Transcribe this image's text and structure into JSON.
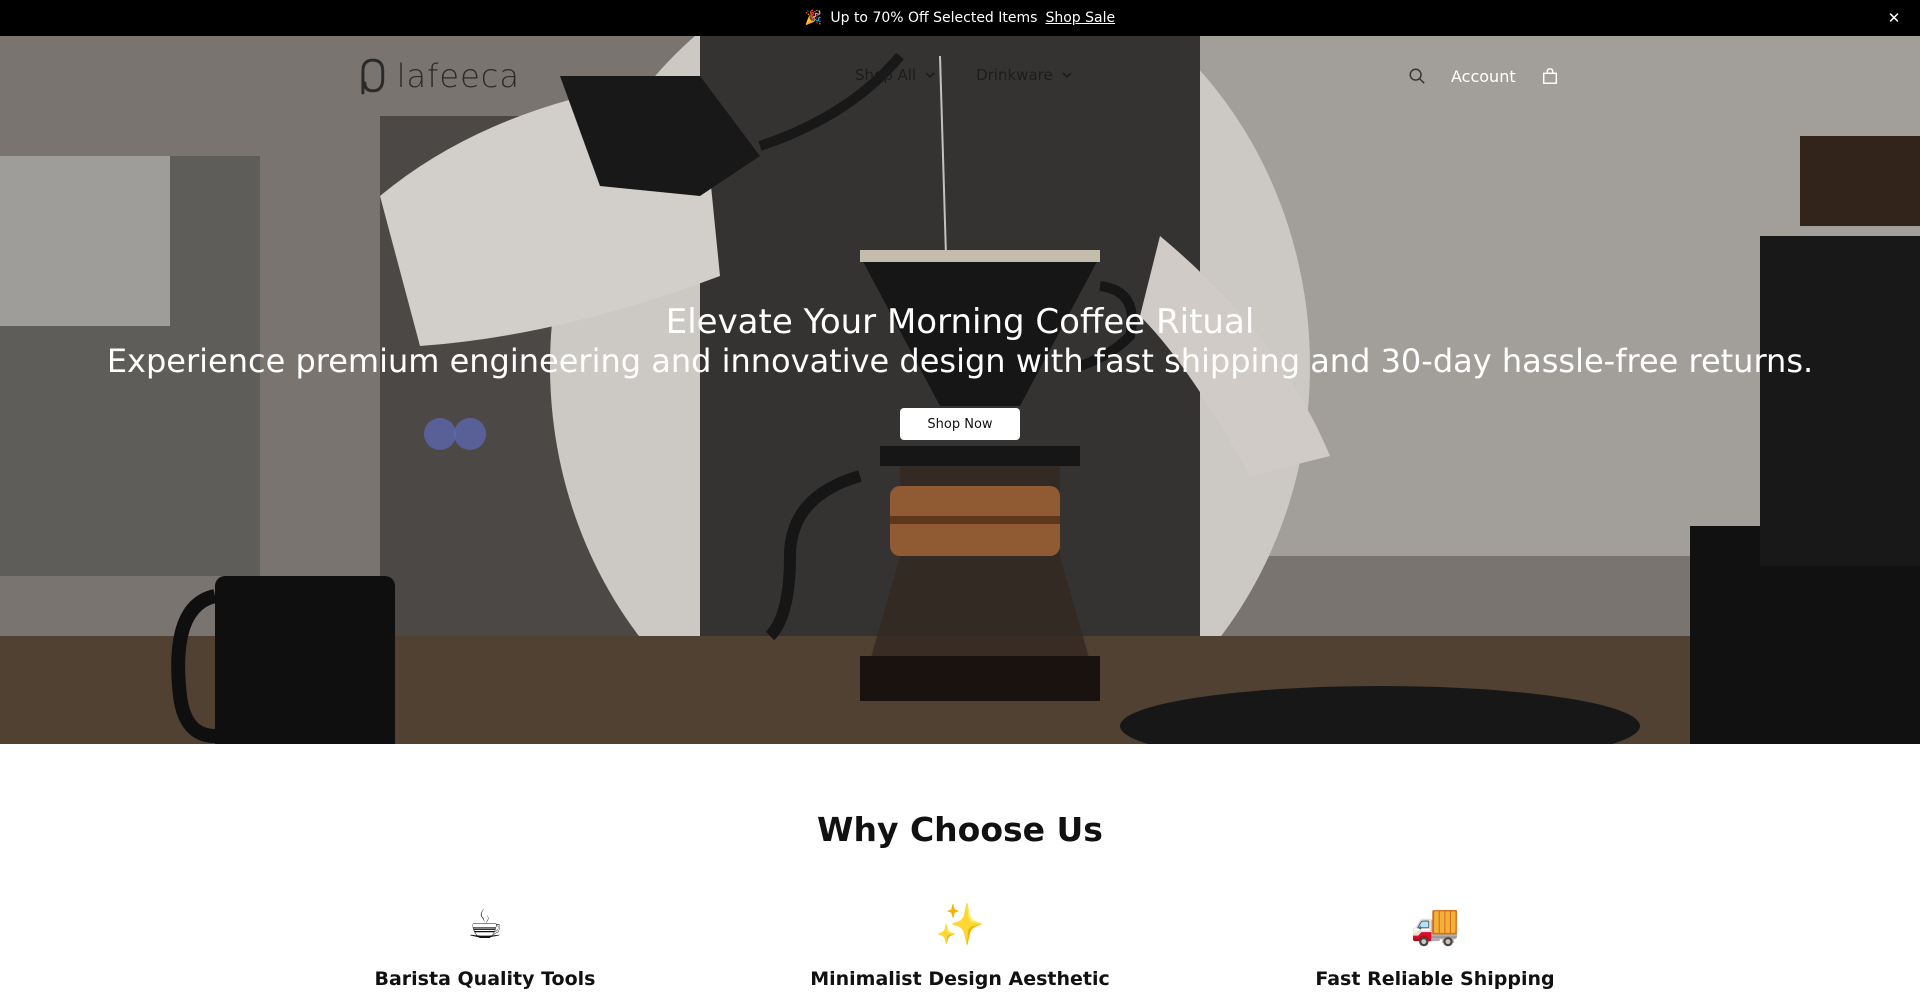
{
  "announcement": {
    "emoji": "🎉",
    "text": "Up to 70% Off Selected Items",
    "link": "Shop Sale",
    "close_icon": "close-icon"
  },
  "header": {
    "logo_text": "lafeeca",
    "nav": [
      {
        "label": "Shop All",
        "icon": "chevron-down-icon"
      },
      {
        "label": "Drinkware",
        "icon": "chevron-down-icon"
      }
    ],
    "account_label": "Account",
    "search_icon": "search-icon",
    "cart_icon": "bag-icon"
  },
  "hero": {
    "title": "Elevate Your Morning Coffee Ritual",
    "subtitle": "Experience premium engineering and innovative design with fast shipping and 30-day hassle-free returns.",
    "button_label": "Shop Now"
  },
  "why": {
    "title": "Why Choose Us",
    "features": [
      {
        "emoji": "☕",
        "label": "Barista Quality Tools"
      },
      {
        "emoji": "✨",
        "label": "Minimalist Design Aesthetic"
      },
      {
        "emoji": "🚚",
        "label": "Fast Reliable Shipping"
      }
    ]
  },
  "colors": {
    "announcement_bg": "#000000",
    "button_bg": "#ffffff",
    "text_dark": "#111111"
  }
}
